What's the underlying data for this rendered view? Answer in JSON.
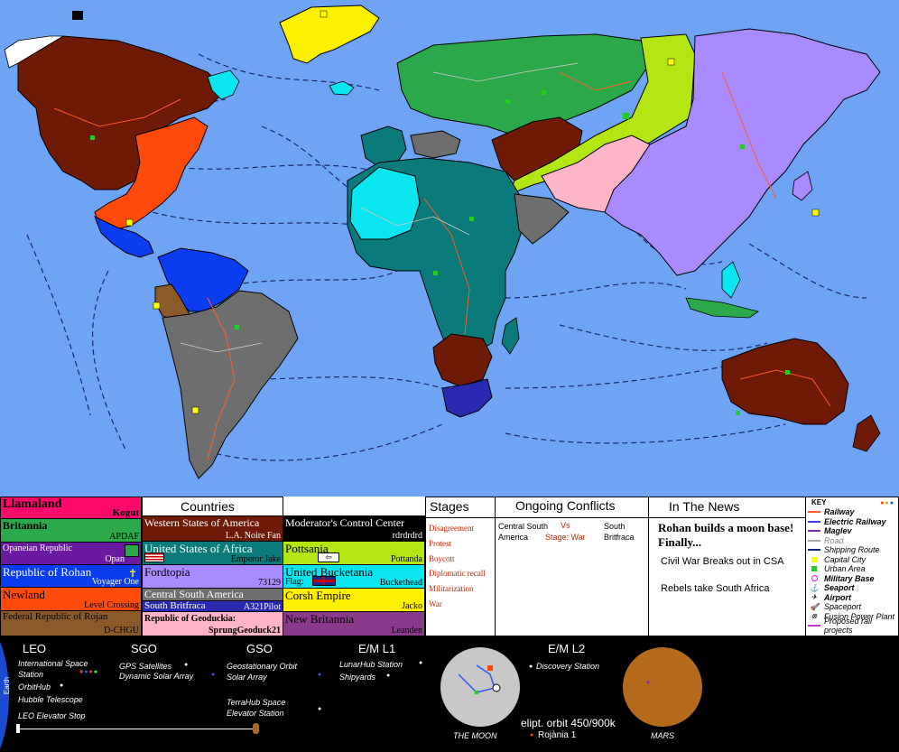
{
  "countries_title": "Countries",
  "countries": [
    {
      "name": "Llamaland",
      "ruler": "Kogut",
      "color": "#ff0a6c",
      "text": "#000"
    },
    {
      "name": "Britannia",
      "ruler": "APDAF",
      "color": "#2aa84a",
      "text": "#000"
    },
    {
      "name": "Opaneian Republic",
      "ruler": "Opan",
      "color": "#6a1aa0",
      "text": "#fff"
    },
    {
      "name": "Republic of Rohan",
      "ruler": "Voyager One",
      "color": "#0a3cf0",
      "text": "#fff"
    },
    {
      "name": "Newland",
      "ruler": "Level Crossing",
      "color": "#ff4a0a",
      "text": "#000"
    },
    {
      "name": "Federal Republic of Rojan",
      "ruler": "D-CHGU",
      "color": "#8a5a2a",
      "text": "#000"
    },
    {
      "name": "Western States of America",
      "ruler": "L.A. Noire Fan",
      "color": "#6e1a06",
      "text": "#fff"
    },
    {
      "name": "United States of Africa",
      "ruler": "Emperor Jake",
      "color": "#0a7a7a",
      "text": "#000"
    },
    {
      "name": "Fordtopia",
      "ruler": "73129",
      "color": "#a98aff",
      "text": "#000"
    },
    {
      "name": "Central South America",
      "ruler": "A321Pilot",
      "color": "#6e6e6e",
      "text": "#fff"
    },
    {
      "name": "South Britfraca",
      "ruler": "",
      "color": "#2a2ab0",
      "text": "#fff"
    },
    {
      "name": "Republic of Geoduckia:",
      "ruler": "SprungGeoduck21",
      "color": "#ffb4c8",
      "text": "#000"
    },
    {
      "name": "Moderator's Control Center",
      "ruler": "rdrdrdrd",
      "color": "#000000",
      "text": "#fff"
    },
    {
      "name": "Pottsania",
      "ruler": "Pottanda",
      "color": "#b4e614",
      "text": "#000"
    },
    {
      "name": "United Bucketania",
      "ruler": "Buckethead",
      "color": "#0ae6f0",
      "text": "#000"
    },
    {
      "name": "Flag:",
      "ruler": "",
      "color": "#0ae6f0",
      "text": "#000"
    },
    {
      "name": "Corsh Empire",
      "ruler": "Jacko",
      "color": "#fff000",
      "text": "#000"
    },
    {
      "name": "New Britannia",
      "ruler": "Leanden",
      "color": "#8a3a8a",
      "text": "#000"
    }
  ],
  "stages": {
    "title": "Stages",
    "items": [
      "Disagreement",
      "Protest",
      "Boycott",
      "Diplomatic recall",
      "Militarization",
      "War"
    ]
  },
  "conflicts": {
    "title": "Ongoing Conflicts",
    "side_a": "Central South America",
    "vs": "Vs",
    "side_b": "South Britfraca",
    "stage": "Stage: War"
  },
  "news": {
    "title": "In The News",
    "headline": "Rohan builds a moon base! Finally...",
    "items": [
      "Civil War Breaks out in CSA",
      "Rebels take South Africa"
    ]
  },
  "key": {
    "title": "KEY",
    "items": [
      {
        "label": "Railway",
        "color": "#ff5a28",
        "kind": "line"
      },
      {
        "label": "Electric Railway",
        "color": "#3a3aff",
        "kind": "line"
      },
      {
        "label": "Maglev",
        "color": "#7a2aaa",
        "kind": "line"
      },
      {
        "label": "Road",
        "color": "#aaaaaa",
        "kind": "line"
      },
      {
        "label": "Shipping Route",
        "color": "#0a2a7a",
        "kind": "line"
      },
      {
        "label": "Capital City",
        "color": "#ffff00",
        "kind": "square"
      },
      {
        "label": "Urban Area",
        "color": "#22cc22",
        "kind": "square"
      },
      {
        "label": "Military Base",
        "color": "#ff00ff",
        "kind": "circle"
      },
      {
        "label": "Seaport",
        "color": "#000000",
        "kind": "glyph"
      },
      {
        "label": "Airport",
        "color": "#000000",
        "kind": "glyph"
      },
      {
        "label": "Spaceport",
        "color": "#7a2aaa",
        "kind": "glyph"
      },
      {
        "label": "Fusion Power Plant",
        "color": "#000000",
        "kind": "glyph"
      },
      {
        "label": "Proposed rail projects",
        "color": "#cc33cc",
        "kind": "line"
      }
    ]
  },
  "space": {
    "earth_label": "Earth",
    "leo": {
      "title": "LEO",
      "items": [
        "International Space Station",
        "OrbitHub",
        "Hubble Telescope",
        "LEO Elevator Stop"
      ]
    },
    "sgo": {
      "title": "SGO",
      "items": [
        "GPS Satellites",
        "Dynamic Solar Array"
      ]
    },
    "gso": {
      "title": "GSO",
      "items": [
        "Geostationary Orbit Solar Array",
        "TerraHub Space Elevator Station"
      ]
    },
    "l1": {
      "title": "E/M L1",
      "items": [
        "LunarHub Station",
        "Shipyards"
      ]
    },
    "l2": {
      "title": "E/M L2",
      "items": [
        "Discovery Station"
      ]
    },
    "moon_label": "THE MOON",
    "mars_label": "MARS",
    "orbit_note": "elipt. orbit 450/900k",
    "rojania": "Rojània 1"
  },
  "colors": {
    "ocean": "#6fa3f4"
  }
}
